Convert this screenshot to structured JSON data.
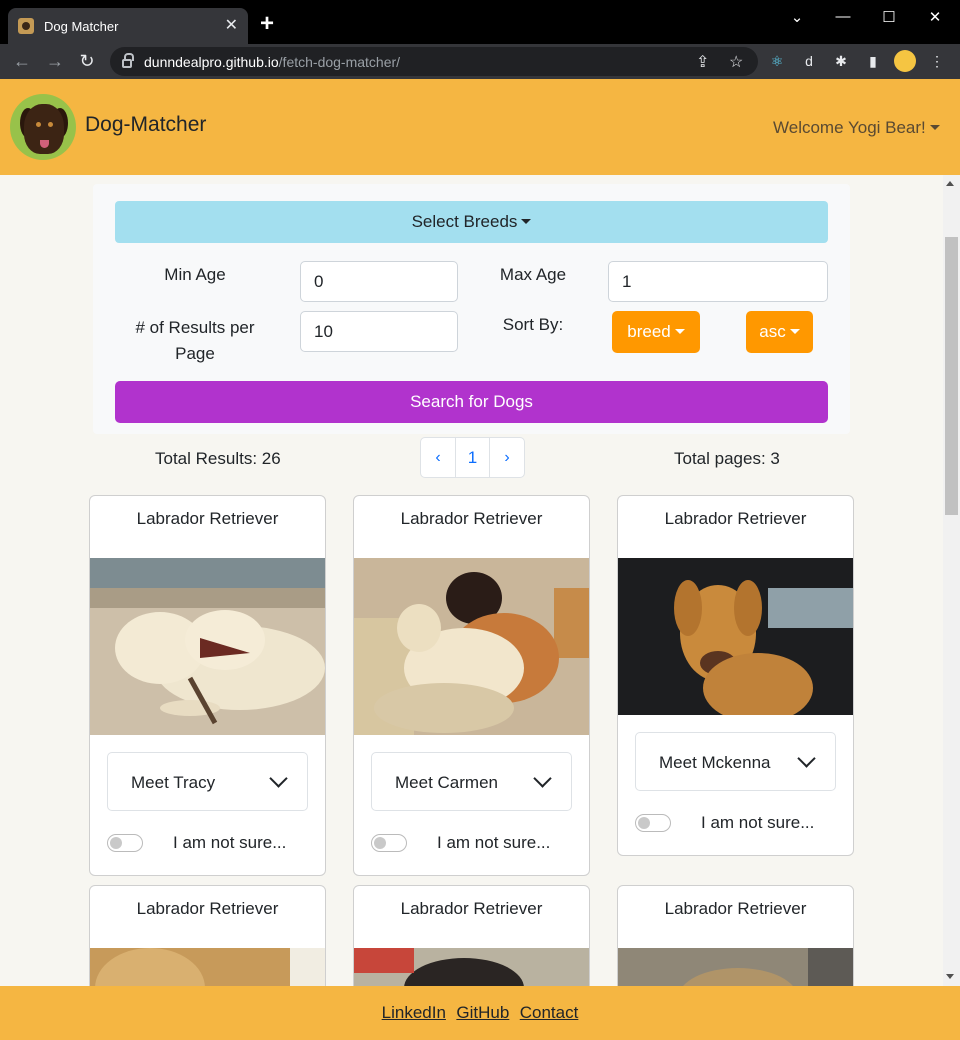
{
  "browser": {
    "tab_title": "Dog Matcher",
    "tab_close": "✕",
    "new_tab": "+",
    "url_host": "dunndealpro.github.io",
    "url_path": "/fetch-dog-matcher/"
  },
  "navbar": {
    "brand": "Dog-Matcher",
    "welcome": "Welcome Yogi Bear!"
  },
  "filters": {
    "select_breeds": "Select Breeds",
    "min_age_label": "Min Age",
    "min_age_value": "0",
    "max_age_label": "Max Age",
    "max_age_value": "1",
    "results_per_page_label": "# of Results per Page",
    "results_per_page_value": "10",
    "sort_by_label": "Sort By:",
    "sort_field": "breed",
    "sort_order": "asc",
    "search_button": "Search for Dogs"
  },
  "results": {
    "total_results": "Total Results: 26",
    "total_pages": "Total pages: 3",
    "pager_prev": "‹",
    "pager_current": "1",
    "pager_next": "›"
  },
  "cards": [
    {
      "breed": "Labrador Retriever",
      "meet": "Meet Tracy",
      "toggle_label": "I am not sure..."
    },
    {
      "breed": "Labrador Retriever",
      "meet": "Meet Carmen",
      "toggle_label": "I am not sure..."
    },
    {
      "breed": "Labrador Retriever",
      "meet": "Meet Mckenna",
      "toggle_label": "I am not sure..."
    },
    {
      "breed": "Labrador Retriever"
    },
    {
      "breed": "Labrador Retriever"
    },
    {
      "breed": "Labrador Retriever"
    }
  ],
  "footer": {
    "linkedin": "LinkedIn",
    "github": "GitHub",
    "contact": "Contact"
  },
  "colors": {
    "navbar_bg": "#f5b642",
    "breeds_button": "#a3dfef",
    "sort_buttons": "#ff9800",
    "search_button": "#b133cd"
  }
}
